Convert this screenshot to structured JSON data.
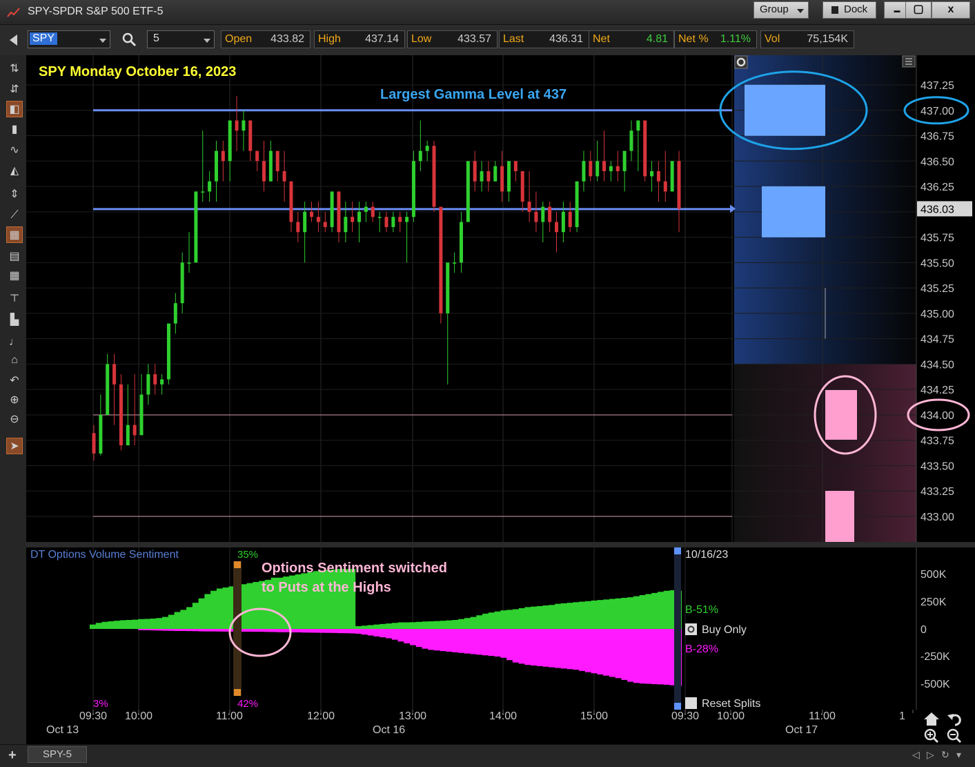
{
  "window": {
    "title": "SPY-SPDR S&P 500 ETF-5",
    "group_label": "Group",
    "dock_label": "Dock",
    "minimize": "▬",
    "maximize": "▢",
    "close": "x"
  },
  "quote": {
    "symbol": "SPY",
    "interval": "5",
    "fields": [
      {
        "label": "Open",
        "value": "433.82"
      },
      {
        "label": "High",
        "value": "437.14"
      },
      {
        "label": "Low",
        "value": "433.57"
      },
      {
        "label": "Last",
        "value": "436.31"
      },
      {
        "label": "Net",
        "value": "4.81"
      },
      {
        "label": "Net %",
        "value": "1.11%"
      },
      {
        "label": "Vol",
        "value": "75,154K"
      }
    ]
  },
  "drawing_tools": [
    "cursor-crosshair",
    "tool-b",
    "candle-tool",
    "bar-tool",
    "line-tool",
    "area-tool",
    "scale-tool",
    "trend-tool",
    "grid-tool",
    "table-tool",
    "grid2-tool",
    "hline-tool",
    "tool-m",
    "tool-n",
    "home-icon",
    "undo-icon",
    "zoom-in-icon",
    "zoom-out-icon",
    "pointer-icon"
  ],
  "chart": {
    "headline": "SPY Monday October 16, 2023",
    "gamma_note": "Largest Gamma Level at 437",
    "price_ticks": [
      "437.25",
      "437.00",
      "436.75",
      "436.50",
      "436.25",
      "436.03",
      "435.75",
      "435.50",
      "435.25",
      "435.00",
      "434.75",
      "434.50",
      "434.25",
      "434.00",
      "433.75",
      "433.50",
      "433.25",
      "433.00"
    ],
    "last_price_label": "436.03",
    "colors": {
      "up": "#2fd02f",
      "down": "#d8343a",
      "gamma_line": "#6b8ef5",
      "blue_box": "#6aa6ff",
      "pink_box": "#ff9fcf",
      "circle_blue": "#1ea3e8",
      "circle_pink": "#ffb6d5",
      "headline": "#ffff33",
      "gamma_note": "#3aa6f0"
    }
  },
  "chart_data": {
    "type": "candlestick",
    "price_range": [
      432.85,
      437.42
    ],
    "candles": [
      [
        433.82,
        433.9,
        433.55,
        433.62
      ],
      [
        433.62,
        434.2,
        433.6,
        434.0
      ],
      [
        434.0,
        434.6,
        434.0,
        434.5
      ],
      [
        434.5,
        434.6,
        433.9,
        434.3
      ],
      [
        434.3,
        434.4,
        433.65,
        433.7
      ],
      [
        433.7,
        434.3,
        433.7,
        433.9
      ],
      [
        433.9,
        434.4,
        433.7,
        433.8
      ],
      [
        433.8,
        434.4,
        433.8,
        434.2
      ],
      [
        434.2,
        434.5,
        434.1,
        434.4
      ],
      [
        434.4,
        434.5,
        434.2,
        434.3
      ],
      [
        434.3,
        434.4,
        434.2,
        434.35
      ],
      [
        434.35,
        434.9,
        434.3,
        434.9
      ],
      [
        434.9,
        435.2,
        434.8,
        435.1
      ],
      [
        435.1,
        435.6,
        435.0,
        435.5
      ],
      [
        435.5,
        435.8,
        435.4,
        435.5
      ],
      [
        435.5,
        436.2,
        435.5,
        436.2
      ],
      [
        436.2,
        436.8,
        436.1,
        436.2
      ],
      [
        436.2,
        436.4,
        436.1,
        436.3
      ],
      [
        436.3,
        436.7,
        436.1,
        436.6
      ],
      [
        436.6,
        436.7,
        436.3,
        436.5
      ],
      [
        436.5,
        436.9,
        436.3,
        436.9
      ],
      [
        436.9,
        437.14,
        436.6,
        436.8
      ],
      [
        436.8,
        437.0,
        436.6,
        436.9
      ],
      [
        436.9,
        436.9,
        436.5,
        436.6
      ],
      [
        436.6,
        436.6,
        436.4,
        436.5
      ],
      [
        436.5,
        436.7,
        436.2,
        436.3
      ],
      [
        436.3,
        436.7,
        436.3,
        436.6
      ],
      [
        436.6,
        436.6,
        436.3,
        436.4
      ],
      [
        436.4,
        436.6,
        436.1,
        436.3
      ],
      [
        436.3,
        436.3,
        435.8,
        435.9
      ],
      [
        435.9,
        436.0,
        435.7,
        435.8
      ],
      [
        435.8,
        436.1,
        435.5,
        436.0
      ],
      [
        436.0,
        436.1,
        435.9,
        435.95
      ],
      [
        435.95,
        436.1,
        435.8,
        435.9
      ],
      [
        435.9,
        436.0,
        435.8,
        435.85
      ],
      [
        435.85,
        436.2,
        435.8,
        436.2
      ],
      [
        436.2,
        436.2,
        435.7,
        435.8
      ],
      [
        435.8,
        436.1,
        435.7,
        435.95
      ],
      [
        435.95,
        436.1,
        435.8,
        435.9
      ],
      [
        435.9,
        436.1,
        435.7,
        436.0
      ],
      [
        436.0,
        436.1,
        435.9,
        436.05
      ],
      [
        436.05,
        436.1,
        435.9,
        435.95
      ],
      [
        435.95,
        436.0,
        435.8,
        435.95
      ],
      [
        435.95,
        436.0,
        435.8,
        435.85
      ],
      [
        435.85,
        436.0,
        435.8,
        435.95
      ],
      [
        435.95,
        436.0,
        435.8,
        435.9
      ],
      [
        435.9,
        436.0,
        435.5,
        435.95
      ],
      [
        435.95,
        436.6,
        435.9,
        436.5
      ],
      [
        436.5,
        436.9,
        436.4,
        436.6
      ],
      [
        436.6,
        436.7,
        436.5,
        436.65
      ],
      [
        436.65,
        436.7,
        436.0,
        436.05
      ],
      [
        436.05,
        436.05,
        434.9,
        435.0
      ],
      [
        435.0,
        435.5,
        434.3,
        435.5
      ],
      [
        435.5,
        435.6,
        435.4,
        435.5
      ],
      [
        435.5,
        436.0,
        435.4,
        435.9
      ],
      [
        435.9,
        436.5,
        435.9,
        436.5
      ],
      [
        436.5,
        436.6,
        436.2,
        436.3
      ],
      [
        436.3,
        436.5,
        436.2,
        436.4
      ],
      [
        436.4,
        436.5,
        436.2,
        436.3
      ],
      [
        436.3,
        436.5,
        436.3,
        436.45
      ],
      [
        436.45,
        436.6,
        436.1,
        436.2
      ],
      [
        436.2,
        436.5,
        436.1,
        436.5
      ],
      [
        436.5,
        436.5,
        436.3,
        436.4
      ],
      [
        436.4,
        436.4,
        436.0,
        436.1
      ],
      [
        436.1,
        436.4,
        435.9,
        436.0
      ],
      [
        436.0,
        436.2,
        435.8,
        435.9
      ],
      [
        435.9,
        436.1,
        435.7,
        436.05
      ],
      [
        436.05,
        436.1,
        435.8,
        435.9
      ],
      [
        435.9,
        436.0,
        435.6,
        435.8
      ],
      [
        435.8,
        436.1,
        435.7,
        436.0
      ],
      [
        436.0,
        436.1,
        435.8,
        435.85
      ],
      [
        435.85,
        436.3,
        435.8,
        436.3
      ],
      [
        436.3,
        436.6,
        436.2,
        436.5
      ],
      [
        436.5,
        436.6,
        436.3,
        436.35
      ],
      [
        436.35,
        436.7,
        436.3,
        436.5
      ],
      [
        436.5,
        436.8,
        436.3,
        436.4
      ],
      [
        436.4,
        436.5,
        436.3,
        436.45
      ],
      [
        436.45,
        436.6,
        436.3,
        436.4
      ],
      [
        436.4,
        436.5,
        436.2,
        436.6
      ],
      [
        436.6,
        436.9,
        436.5,
        436.8
      ],
      [
        436.8,
        436.9,
        436.4,
        436.9
      ],
      [
        436.9,
        436.9,
        436.3,
        436.35
      ],
      [
        436.35,
        436.5,
        436.2,
        436.4
      ],
      [
        436.4,
        436.5,
        436.1,
        436.3
      ],
      [
        436.3,
        436.6,
        436.1,
        436.2
      ],
      [
        436.2,
        436.5,
        436.2,
        436.5
      ],
      [
        436.5,
        436.6,
        435.8,
        436.03
      ]
    ],
    "levels": [
      437.0,
      436.03,
      434.0,
      433.0
    ],
    "gex_bars": [
      {
        "price": 437.0,
        "side": "call"
      },
      {
        "price": 436.0,
        "side": "call"
      },
      {
        "price": 434.0,
        "side": "put"
      },
      {
        "price": 433.0,
        "side": "put"
      }
    ],
    "indicator": {
      "title": "DT Options Volume Sentiment",
      "y_ticks": [
        "500K",
        "250K",
        "0",
        "-250K",
        "-500K"
      ],
      "pct_top": "35%",
      "pct_bottom": "42%",
      "pct_left": "3%",
      "date_label": "10/16/23",
      "buy_label": "B-51%",
      "sell_label": "B-28%",
      "buy_only": "Buy Only",
      "reset_splits": "Reset Splits",
      "note_line1": "Options Sentiment switched",
      "note_line2": "to Puts at the Highs",
      "buy": [
        40,
        55,
        65,
        70,
        75,
        80,
        82,
        85,
        90,
        92,
        95,
        100,
        110,
        130,
        155,
        175,
        200,
        240,
        280,
        320,
        350,
        370,
        380,
        390,
        400,
        410,
        420,
        430,
        440,
        450,
        470,
        470,
        480,
        490,
        500,
        510,
        520,
        530,
        535,
        540,
        545,
        550,
        548,
        550,
        25,
        30,
        35,
        40,
        45,
        50,
        55,
        60,
        60,
        62,
        65,
        68,
        70,
        72,
        75,
        78,
        82,
        90,
        100,
        110,
        125,
        140,
        150,
        160,
        170,
        175,
        180,
        190,
        200,
        205,
        210,
        215,
        220,
        230,
        235,
        240,
        245,
        250,
        255,
        260,
        265,
        270,
        275,
        280,
        285,
        290,
        300,
        310,
        320,
        330,
        340,
        350,
        355,
        350
      ],
      "sell": [
        0,
        0,
        0,
        0,
        0,
        0,
        0,
        0,
        -20,
        -22,
        -25,
        -28,
        -30,
        -32,
        -34,
        -35,
        -36,
        -38,
        -40,
        -42,
        -42,
        -43,
        -44,
        -45,
        -45,
        -46,
        -46,
        -47,
        -48,
        -50,
        -52,
        -54,
        -55,
        -57,
        -58,
        -60,
        -62,
        -64,
        -65,
        -66,
        -68,
        -70,
        -72,
        -75,
        -80,
        -95,
        -110,
        -125,
        -140,
        -155,
        -180,
        -210,
        -240,
        -270,
        -300,
        -330,
        -350,
        -360,
        -370,
        -380,
        -390,
        -400,
        -410,
        -420,
        -430,
        -440,
        -450,
        -460,
        -480,
        -520,
        -560,
        -580,
        -600,
        -610,
        -620,
        -630,
        -640,
        -650,
        -660,
        -670,
        -680,
        -700,
        -720,
        -740,
        -760,
        -780,
        -800,
        -820,
        -850,
        -880,
        -900,
        -910,
        -915,
        -920,
        -925,
        -930,
        -940,
        -950
      ]
    }
  },
  "time_axis": {
    "ticks": [
      {
        "label": "09:30",
        "row": 1
      },
      {
        "label": "10:00",
        "row": 1
      },
      {
        "label": "11:00",
        "row": 1
      },
      {
        "label": "12:00",
        "row": 1
      },
      {
        "label": "13:00",
        "row": 1
      },
      {
        "label": "14:00",
        "row": 1
      },
      {
        "label": "15:00",
        "row": 1
      },
      {
        "label": "09:30",
        "row": 1
      },
      {
        "label": "10:00",
        "row": 1
      },
      {
        "label": "11:00",
        "row": 1
      },
      {
        "label": "1",
        "row": 1
      }
    ],
    "dates": [
      "Oct 13",
      "Oct 16",
      "Oct 17"
    ]
  },
  "bottom": {
    "tab": "SPY-5",
    "add": "+"
  }
}
